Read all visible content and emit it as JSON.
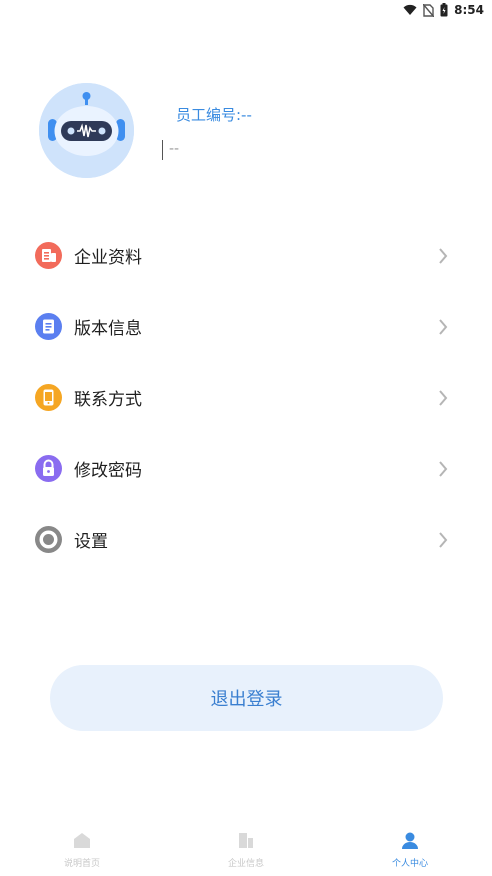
{
  "status_bar": {
    "time": "8:54"
  },
  "profile": {
    "employee_number": "员工编号:--",
    "name": "--"
  },
  "menu": {
    "items": [
      {
        "label": "企业资料",
        "icon": "building-document-icon",
        "color": "#f26b5b"
      },
      {
        "label": "版本信息",
        "icon": "document-list-icon",
        "color": "#5b7ff0"
      },
      {
        "label": "联系方式",
        "icon": "phone-icon",
        "color": "#f5a623"
      },
      {
        "label": "修改密码",
        "icon": "lock-icon",
        "color": "#8a6cf0"
      },
      {
        "label": "设置",
        "icon": "gear-icon",
        "color": "#888888"
      }
    ]
  },
  "logout": {
    "label": "退出登录"
  },
  "bottom_nav": {
    "items": [
      {
        "label": "说明首页",
        "icon": "home-icon",
        "active": false
      },
      {
        "label": "企业信息",
        "icon": "building-icon",
        "active": false
      },
      {
        "label": "个人中心",
        "icon": "person-icon",
        "active": true
      }
    ]
  },
  "colors": {
    "accent": "#3a8be0",
    "logout_bg": "#e8f1fc",
    "avatar_bg": "#cfe3fb"
  }
}
